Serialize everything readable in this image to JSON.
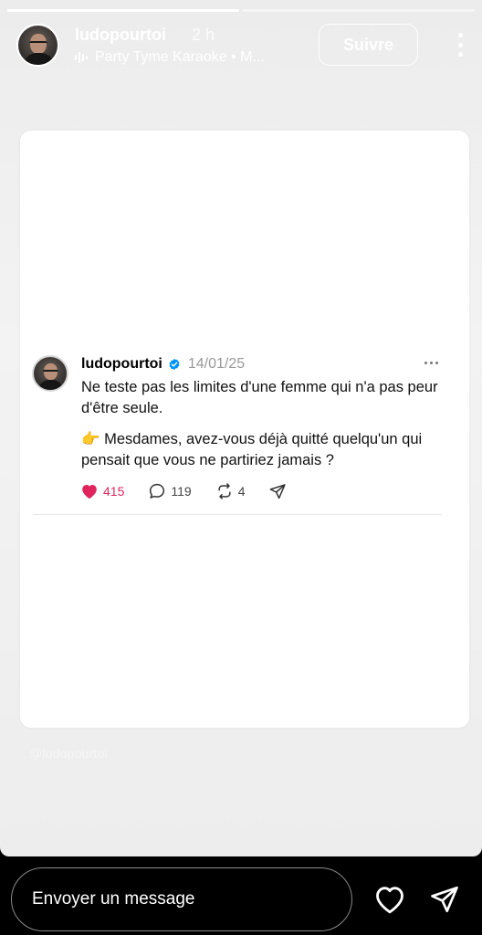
{
  "story": {
    "username": "ludopourtoi",
    "time_ago": "2 h",
    "music_label": "Party Tyme Karaoke • M...",
    "follow_label": "Suivre",
    "progress_fraction": 0.5
  },
  "post": {
    "username": "ludopourtoi",
    "date": "14/01/25",
    "line1": "Ne teste pas les limites d'une femme qui n'a pas peur d'être seule.",
    "line2": "👉 Mesdames, avez-vous déjà quitté quelqu'un qui pensait que vous ne partiriez jamais ?",
    "likes": "415",
    "comments": "119",
    "reposts": "4"
  },
  "watermark": "@ludopourtoi",
  "reply": {
    "placeholder": "Envoyer un message"
  },
  "colors": {
    "like_red": "#e0245e",
    "verified_blue": "#0095f6"
  }
}
